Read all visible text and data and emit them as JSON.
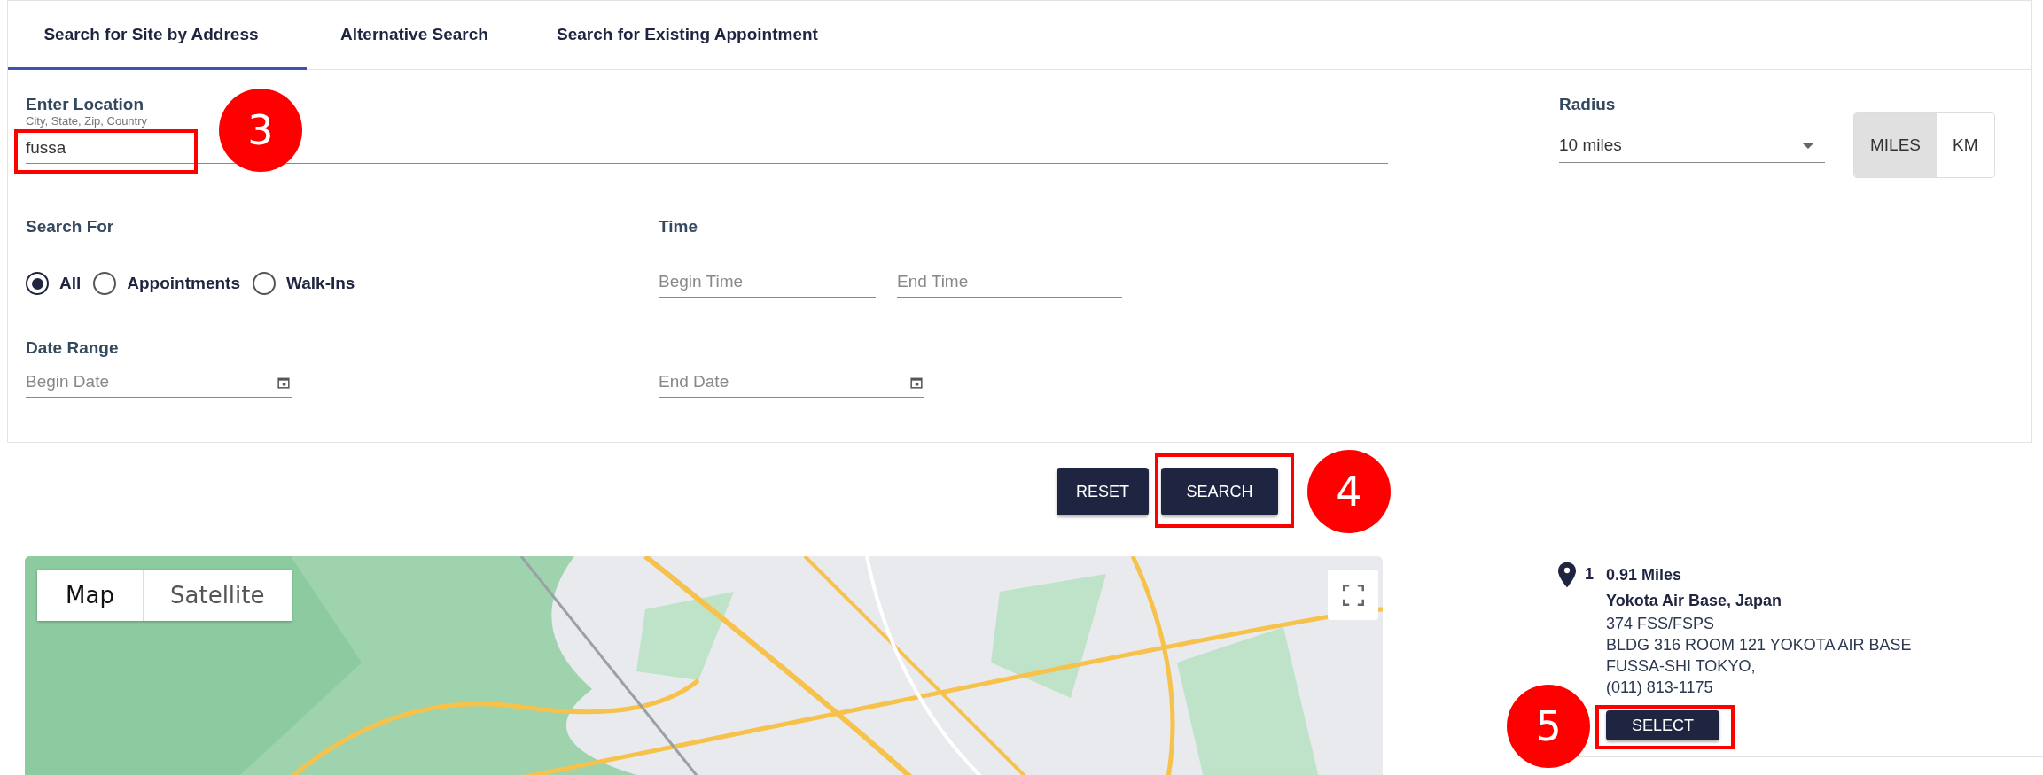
{
  "tabs": [
    {
      "label": "Search for Site by Address",
      "selected": true
    },
    {
      "label": "Alternative Search",
      "selected": false
    },
    {
      "label": "Search for Existing Appointment",
      "selected": false
    }
  ],
  "location": {
    "label": "Enter Location",
    "hint": "City, State, Zip, Country",
    "value": "fussa"
  },
  "radius": {
    "label": "Radius",
    "value": "10 miles",
    "units": [
      {
        "label": "MILES",
        "selected": true
      },
      {
        "label": "KM",
        "selected": false
      }
    ]
  },
  "search_for": {
    "label": "Search For",
    "options": [
      {
        "label": "All",
        "selected": true
      },
      {
        "label": "Appointments",
        "selected": false
      },
      {
        "label": "Walk-Ins",
        "selected": false
      }
    ]
  },
  "time": {
    "label": "Time",
    "begin": {
      "placeholder": "Begin Time"
    },
    "end": {
      "placeholder": "End Time"
    }
  },
  "date_range": {
    "label": "Date Range",
    "begin": {
      "placeholder": "Begin Date"
    },
    "end": {
      "placeholder": "End Date"
    }
  },
  "buttons": [
    "RESET",
    "SEARCH"
  ],
  "map": {
    "kind": "picture",
    "map_types": [
      {
        "label": "Map",
        "selected": true
      },
      {
        "label": "Satellite",
        "selected": false
      }
    ]
  },
  "results": [
    {
      "number": "1",
      "distance": "0.91 Miles",
      "name": "Yokota Air Base, Japan",
      "lines": [
        "374 FSS/FSPS",
        "BLDG 316 ROOM 121 YOKOTA AIR BASE",
        "FUSSA-SHI TOKYO,",
        "(011) 813-1175"
      ],
      "button": "SELECT"
    }
  ],
  "callouts": [
    {
      "number": "3"
    },
    {
      "number": "4"
    },
    {
      "number": "5"
    }
  ]
}
